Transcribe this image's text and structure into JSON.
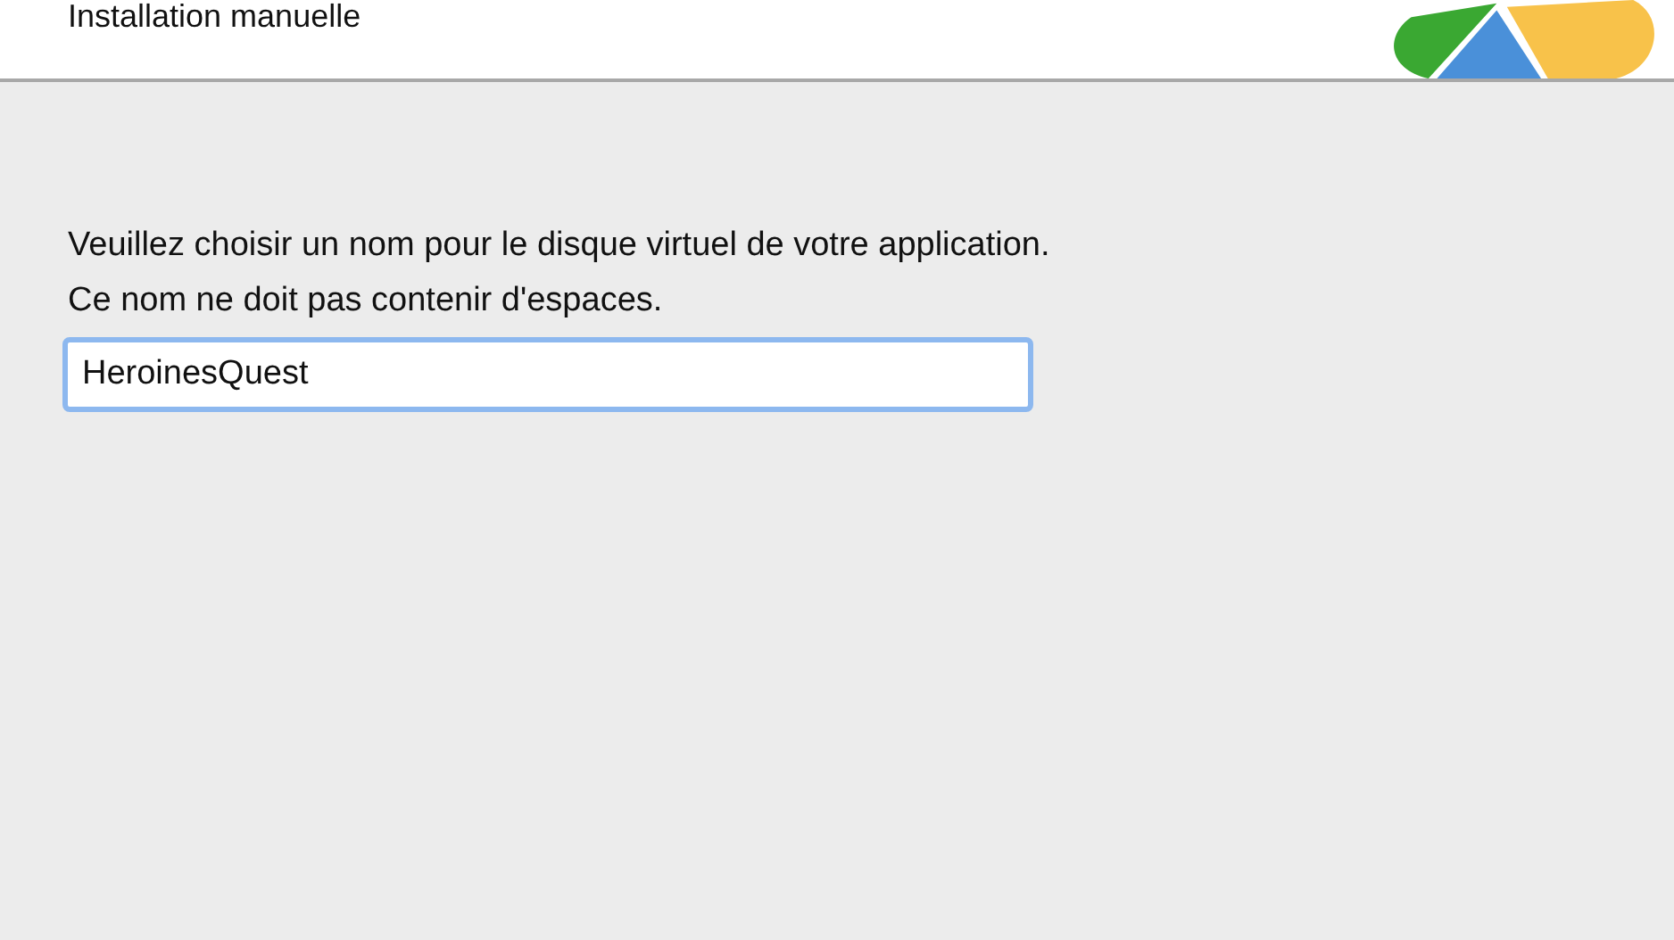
{
  "header": {
    "title": "Installation manuelle"
  },
  "instructions": [
    "Veuillez choisir un nom pour le disque virtuel de votre application.",
    "Ce nom ne doit pas contenir d'espaces."
  ],
  "name_field": {
    "value": "HeroinesQuest",
    "focused": true
  }
}
